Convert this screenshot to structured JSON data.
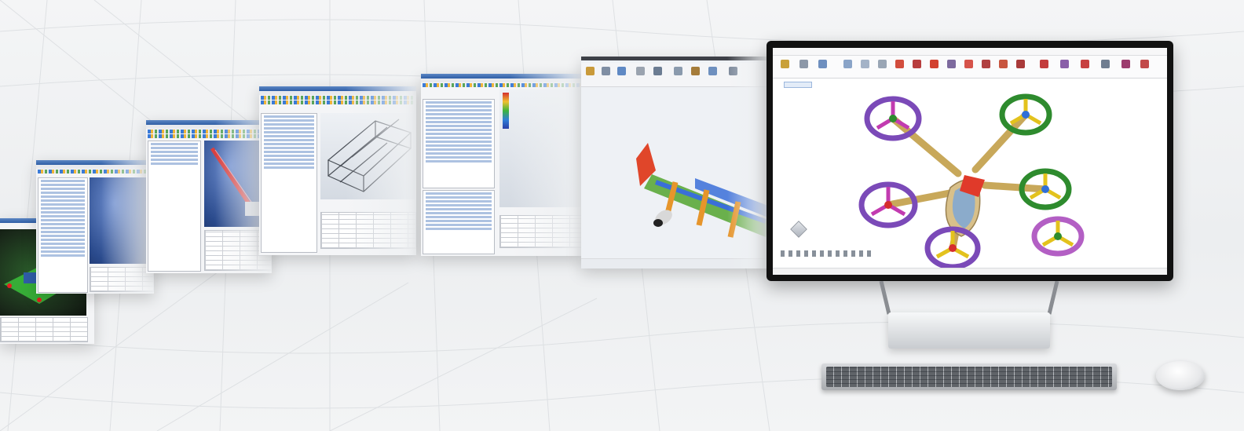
{
  "colors": {
    "background": "#eef0f2",
    "classic_titlebar": "#2f5ea6",
    "viewport_blue": "#2a4a8c",
    "monitor_bezel": "#111111",
    "drone_body": "#d8c08a",
    "drone_canopy": "#7ea7d6",
    "rotor_green": "#2e8b2e",
    "rotor_purple": "#7b4ab8",
    "rotor_magenta": "#c23bb0",
    "rotor_yellow": "#e3c21d",
    "rotor_red": "#d62d2d",
    "aircraft_red": "#e0462a",
    "aircraft_green": "#6ab04c",
    "aircraft_orange": "#e6952b",
    "aircraft_blue": "#3a6fd8"
  },
  "icons": {
    "desktop_monitor": "monitor-icon",
    "keyboard": "keyboard-icon",
    "mouse": "mouse-icon",
    "view_cube": "view-cube-icon"
  }
}
